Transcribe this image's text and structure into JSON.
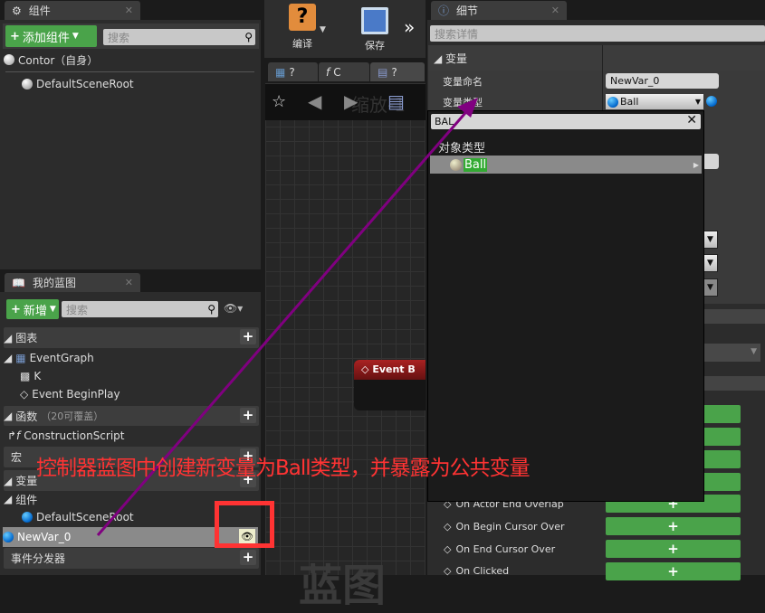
{
  "components_panel": {
    "tab": "组件",
    "add_button": "添加组件",
    "search_placeholder": "搜索",
    "root": "Contor（自身）",
    "items": [
      "DefaultSceneRoot"
    ]
  },
  "toolbar": {
    "compile": "编译",
    "save": "保存",
    "more": "»"
  },
  "graph": {
    "tabs": [
      "?",
      "C",
      "?"
    ],
    "zoom_label": "缩放-1",
    "node_title": "Event B",
    "watermark": "蓝图"
  },
  "my_blueprint": {
    "tab": "我的蓝图",
    "new_button": "新增",
    "search_placeholder": "搜索",
    "sections": {
      "graphs": "图表",
      "functions": "函数",
      "functions_note": "（20可覆盖）",
      "macros": "宏",
      "variables": "变量",
      "components": "组件",
      "dispatchers": "事件分发器"
    },
    "graph_items": [
      "EventGraph",
      "K",
      "Event BeginPlay"
    ],
    "function_items": [
      "ConstructionScript"
    ],
    "component_items": [
      "DefaultSceneRoot"
    ],
    "variable_selected": "NewVar_0"
  },
  "details": {
    "tab": "细节",
    "search_placeholder": "搜索详情",
    "section": "变量",
    "name_label": "变量命名",
    "name_value": "NewVar_0",
    "type_label": "变量类型",
    "type_value": "Ball",
    "events": [
      "On Actor End Overlap",
      "On Begin Cursor Over",
      "On End Cursor Over",
      "On Clicked"
    ]
  },
  "type_picker": {
    "search_value": "BAL",
    "category": "对象类型",
    "item": "Ball"
  },
  "annotation": {
    "text": "控制器蓝图中创建新变量为Ball类型，并暴露为公共变量",
    "text_color": "#ff3333",
    "arrow_color": "#800080",
    "box_color": "#ff3333"
  }
}
